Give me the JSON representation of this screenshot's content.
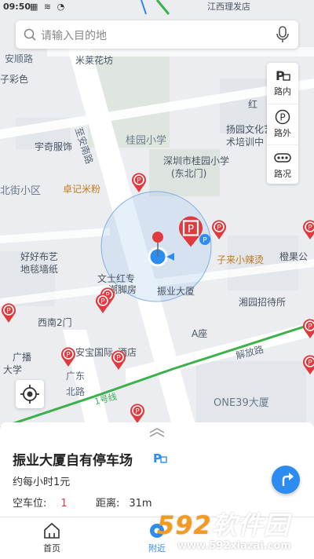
{
  "status": {
    "time": "09:50"
  },
  "search": {
    "placeholder": "请输入目的地"
  },
  "right_panel": {
    "items": [
      {
        "label": "路内",
        "icon": "parking-lot-icon"
      },
      {
        "label": "路外",
        "icon": "parking-circle-icon"
      },
      {
        "label": "路况",
        "icon": "traffic-icon"
      }
    ]
  },
  "map_labels": {
    "anshun": "安顺路",
    "mlhy": "米莱花坊",
    "hong": "红",
    "sancai": "子彩色",
    "guiyuan_xx": "桂园小学",
    "zhian": "至安南路",
    "yangyuan": "扬园文化艺",
    "yangyuan2": "术培训中",
    "yuqi": "宇奇服饰",
    "sz_guiyuan": "深圳市桂园小学",
    "dongbei": "(东北门)",
    "beijie": "北街小区",
    "zhuoji": "卓记米粉",
    "haoyou": "好好布艺",
    "ditan": "地毯墙纸",
    "wenshi": "文士红专",
    "chaojiaofang": "潮脚房",
    "zilai": "子来小辣烫",
    "chengfu": "橙果公",
    "zhenye": "振业大厦",
    "xiangyuan": "湘园招待所",
    "xinan2": "西南2门",
    "guangbo": "广播",
    "daxue": "大学",
    "anbao": "安宝国际",
    "jiudian": "酒店",
    "azuo": "A座",
    "jiefang": "解放路",
    "guangdong": "广东",
    "beilu": "北路",
    "one39": "ONE39大厦",
    "yihao": "1号线",
    "jiangxi": "江西理发店"
  },
  "place": {
    "name": "振业大厦自有停车场",
    "price": "约每小时1元",
    "spaces_label": "空车位:",
    "spaces_value": "1",
    "distance_label": "距离:",
    "distance_value": "31m"
  },
  "tabs": [
    {
      "label": "首页",
      "icon": "home-icon"
    },
    {
      "label": "附近",
      "icon": "nearby-icon"
    },
    {
      "label": "",
      "icon": ""
    },
    {
      "label": "",
      "icon": ""
    }
  ],
  "watermark": {
    "brand_num": "592",
    "brand_text": "软件园",
    "url": "www.592xiazai.com"
  },
  "colors": {
    "accent": "#2d8cf0",
    "parking_red": "#e0393e",
    "map_bg": "#ebedf0"
  }
}
